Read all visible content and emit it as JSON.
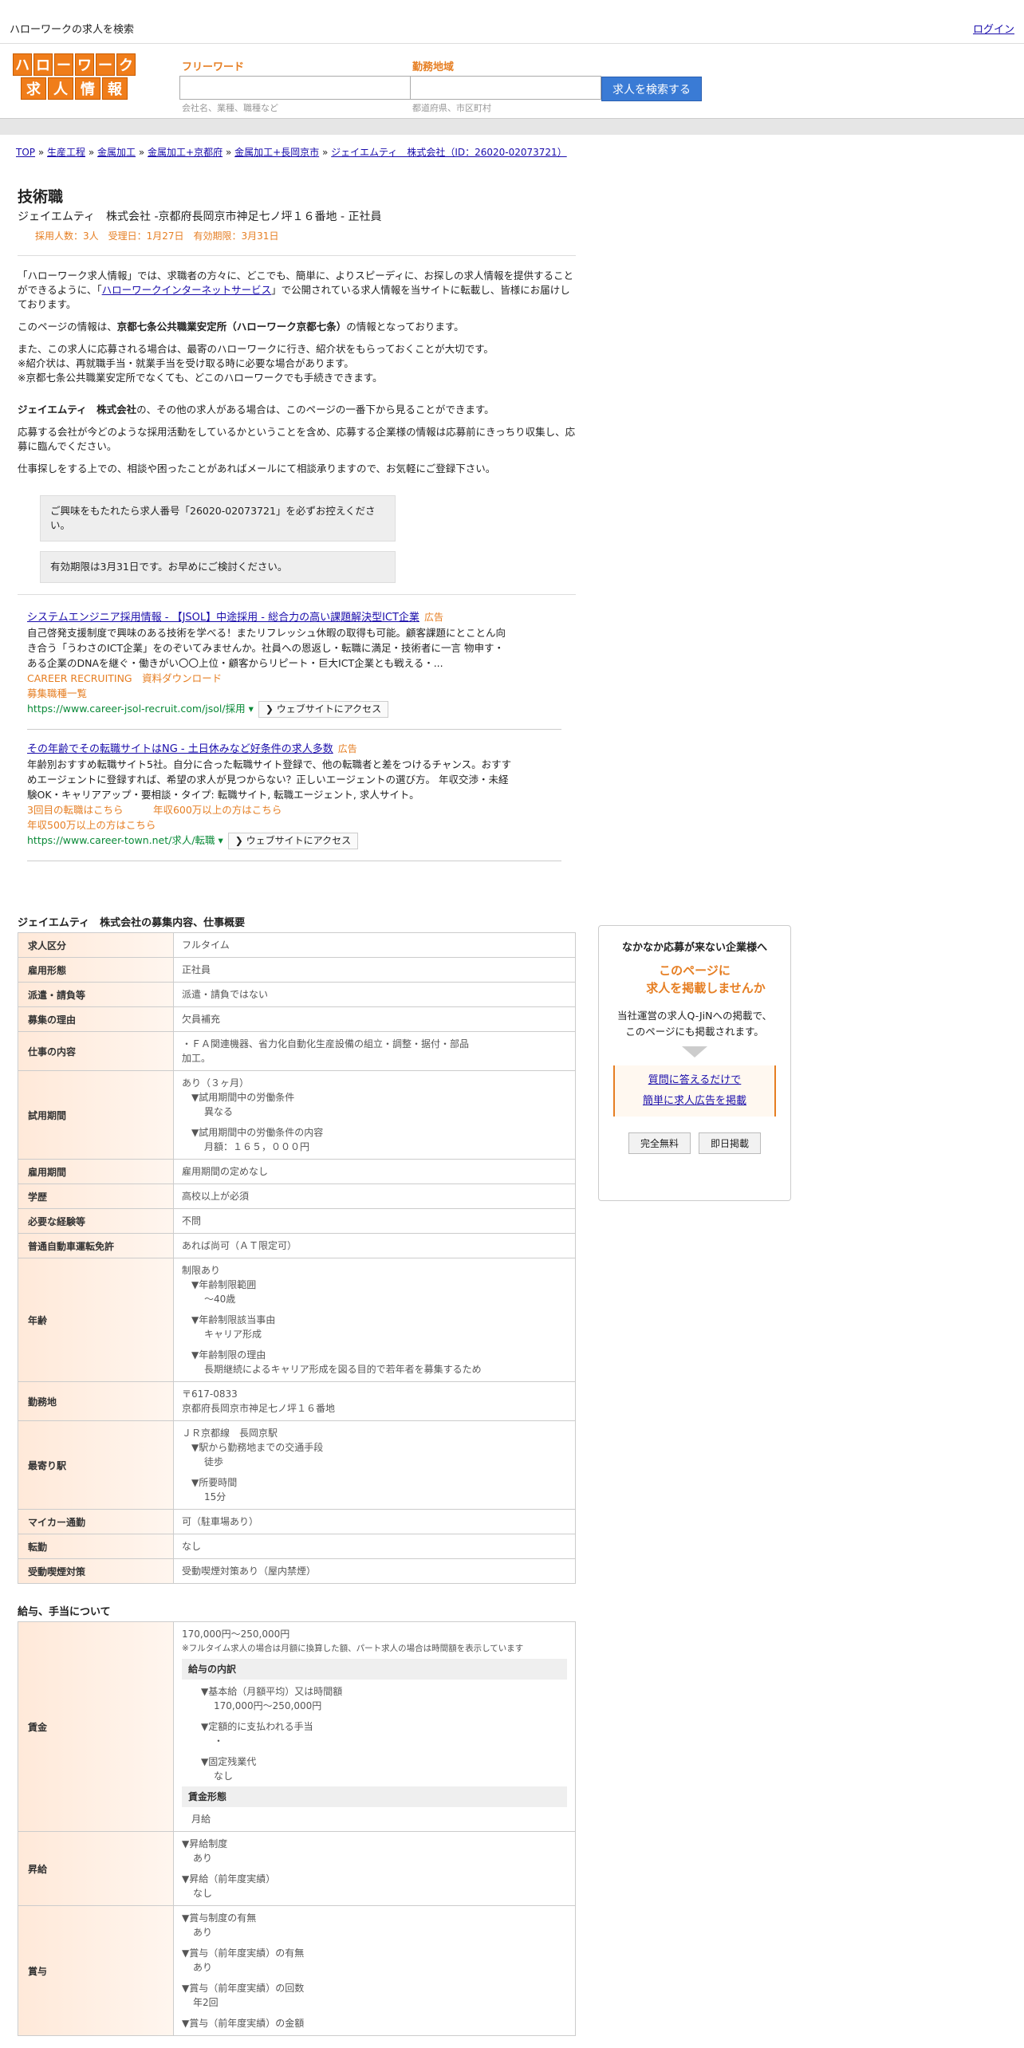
{
  "topbar": {
    "title": "ハローワークの求人を検索",
    "login": "ログイン"
  },
  "logo": {
    "row1": [
      "ハ",
      "ロ",
      "ー",
      "ワ",
      "ー",
      "ク"
    ],
    "row2": [
      "求",
      "人",
      "情",
      "報"
    ]
  },
  "search": {
    "free_label": "フリーワード",
    "free_placeholder": "",
    "free_hint": "会社名、業種、職種など",
    "area_label": "勤務地域",
    "area_hint": "都道府県、市区町村",
    "button": "求人を検索する"
  },
  "breadcrumbs": [
    "TOP",
    "生産工程",
    "金属加工",
    "金属加工+京都府",
    "金属加工+長岡京市",
    "ジェイエムティ　株式会社（ID：26020-02073721）"
  ],
  "breadcrumb_sep": "»",
  "job": {
    "title": "技術職",
    "subtitle": "ジェイエムティ　株式会社 -京都府長岡京市神足七ノ坪１６番地 - 正社員",
    "meta": "採用人数：3人　受理日：1月27日　有効期限：3月31日"
  },
  "intro": {
    "p1a": "「ハローワーク求人情報」では、求職者の方々に、どこでも、簡単に、よりスピーディに、お探しの求人情報を提供することができるように、「",
    "p1link": "ハローワークインターネットサービス",
    "p1b": "」で公開されている求人情報を当サイトに転載し、皆様にお届けしております。",
    "p2a": "このページの情報は、",
    "p2b": "京都七条公共職業安定所（ハローワーク京都七条）",
    "p2c": "の情報となっております。",
    "p3": [
      "また、この求人に応募される場合は、最寄のハローワークに行き、紹介状をもらっておくことが大切です。",
      "※紹介状は、再就職手当・就業手当を受け取る時に必要な場合があります。",
      "※京都七条公共職業安定所でなくても、どこのハローワークでも手続きできます。"
    ],
    "p4a": "ジェイエムティ　株式会社",
    "p4b": "の、その他の求人がある場合は、このページの一番下から見ることができます。",
    "p5": "応募する会社が今どのような採用活動をしているかということを含め、応募する企業様の情報は応募前にきっちり収集し、応募に臨んでください。",
    "p6": "仕事探しをする上での、相談や困ったことがあればメールにて相談承りますので、お気軽にご登録下さい。"
  },
  "notices": [
    "ご興味をもたれたら求人番号「26020-02073721」を必ずお控えください。",
    "有効期限は3月31日です。お早めにご検討ください。"
  ],
  "ads": [
    {
      "title": "システムエンジニア採用情報 - 【JSOL】中途採用 - 総合力の高い課題解決型ICT企業",
      "tag": "広告",
      "body": "自己啓発支援制度で興味のある技術を学べる！またリフレッシュ休暇の取得も可能。顧客課題にとことん向き合う「うわさのICT企業」をのぞいてみませんか。社員への恩返し・転職に満足・技術者に一言 物申す・ある企業のDNAを継ぐ・働きがい〇〇上位・顧客からリピート・巨大ICT企業とも戦える・...",
      "links": [
        "CAREER RECRUITING　資料ダウンロード",
        "募集職種一覧"
      ],
      "url": "https://www.career-jsol-recruit.com/jsol/採用 ▾",
      "visit": "❯ ウェブサイトにアクセス"
    },
    {
      "title": "その年齢でその転職サイトはNG - 土日休みなど好条件の求人多数",
      "tag": "広告",
      "body": "年齢別おすすめ転職サイト5社。自分に合った転職サイト登録で、他の転職者と差をつけるチャンス。おすすめエージェントに登録すれば、希望の求人が見つからない？正しいエージェントの選び方。 年収交渉・未経験OK・キャリアアップ・要相談・タイプ: 転職サイト, 転職エージェント, 求人サイト。",
      "links": [
        "3回目の転職はこちら　　　年収600万以上の方はこちら",
        "年収500万以上の方はこちら"
      ],
      "url": "https://www.career-town.net/求人/転職 ▾",
      "visit": "❯ ウェブサイトにアクセス"
    }
  ],
  "overview": {
    "title": "ジェイエムティ　株式会社の募集内容、仕事概要",
    "rows": [
      {
        "k": "求人区分",
        "v": [
          "フルタイム"
        ]
      },
      {
        "k": "雇用形態",
        "v": [
          "正社員"
        ]
      },
      {
        "k": "派遣・請負等",
        "v": [
          "派遣・請負ではない"
        ]
      },
      {
        "k": "募集の理由",
        "v": [
          "欠員補充"
        ]
      },
      {
        "k": "仕事の内容",
        "v": [
          "・ＦＡ関連機器、省力化自動化生産設備の組立・調整・据付・部品",
          "加工。"
        ]
      },
      {
        "k": "試用期間",
        "v": [
          "あり（３ヶ月）",
          "▼試用期間中の労働条件",
          "異なる",
          "",
          "▼試用期間中の労働条件の内容",
          "月額：１６５，０００円"
        ]
      },
      {
        "k": "雇用期間",
        "v": [
          "雇用期間の定めなし"
        ]
      },
      {
        "k": "学歴",
        "v": [
          "高校以上が必須"
        ]
      },
      {
        "k": "必要な経験等",
        "v": [
          "不問"
        ]
      },
      {
        "k": "普通自動車運転免許",
        "v": [
          "あれば尚可（ＡＴ限定可）"
        ]
      },
      {
        "k": "年齢",
        "v": [
          "制限あり",
          "▼年齢制限範囲",
          "〜40歳",
          "",
          "▼年齢制限該当事由",
          "キャリア形成",
          "",
          "▼年齢制限の理由",
          "長期継続によるキャリア形成を図る目的で若年者を募集するため"
        ]
      },
      {
        "k": "勤務地",
        "v": [
          "〒617-0833",
          "京都府長岡京市神足七ノ坪１６番地"
        ]
      },
      {
        "k": "最寄り駅",
        "v": [
          "ＪＲ京都線　長岡京駅",
          "▼駅から勤務地までの交通手段",
          "徒歩",
          "",
          "▼所要時間",
          "15分"
        ]
      },
      {
        "k": "マイカー通勤",
        "v": [
          "可（駐車場あり）"
        ]
      },
      {
        "k": "転勤",
        "v": [
          "なし"
        ]
      },
      {
        "k": "受動喫煙対策",
        "v": [
          "受動喫煙対策あり（屋内禁煙）"
        ]
      }
    ]
  },
  "salary": {
    "title": "給与、手当について",
    "wage_label": "賃金",
    "wage_range": "170,000円〜250,000円",
    "wage_note": "※フルタイム求人の場合は月額に換算した額、パート求人の場合は時間額を表示しています",
    "breakdown_label": "給与の内訳",
    "breakdown": [
      "▼基本給（月額平均）又は時間額",
      "170,000円〜250,000円",
      "",
      "▼定額的に支払われる手当",
      "・",
      "",
      "▼固定残業代",
      "なし"
    ],
    "form_label": "賃金形態",
    "form_value": "月給",
    "raise_label": "昇給",
    "raise": [
      "▼昇給制度",
      "あり",
      "",
      "▼昇給（前年度実績）",
      "なし"
    ],
    "bonus_label": "賞与",
    "bonus": [
      "▼賞与制度の有無",
      "あり",
      "",
      "▼賞与（前年度実績）の有無",
      "あり",
      "",
      "▼賞与（前年度実績）の回数",
      "年2回",
      "",
      "▼賞与（前年度実績）の金額"
    ]
  },
  "side": {
    "heading": "なかなか応募が来ない企業様へ",
    "orange1": "このページに",
    "orange2": "求人を掲載しませんか",
    "desc1": "当社運営の求人Q-JiNへの掲載で、",
    "desc2": "このページにも掲載されます。",
    "link1": "質問に答えるだけで",
    "link2": "簡単に求人広告を掲載",
    "btn1": "完全無料",
    "btn2": "即日掲載"
  }
}
